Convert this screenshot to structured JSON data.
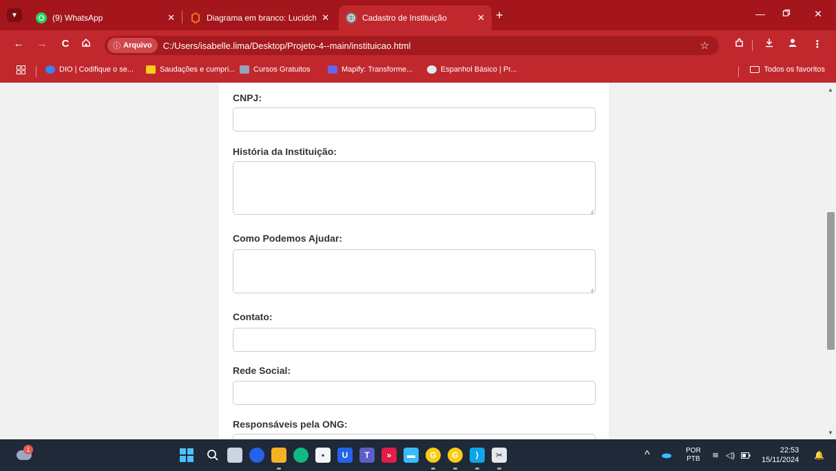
{
  "tabs": [
    {
      "title": "(9) WhatsApp",
      "icon": "whatsapp-icon",
      "active": false
    },
    {
      "title": "Diagrama em branco: Lucidchart",
      "icon": "lucidchart-icon",
      "active": false
    },
    {
      "title": "Cadastro de Instituição",
      "icon": "globe-icon",
      "active": true
    }
  ],
  "address": {
    "chip": "Arquivo",
    "url": "C:/Users/isabelle.lima/Desktop/Projeto-4--main/instituicao.html"
  },
  "bookmarks": [
    {
      "label": "DIO | Codifique o se...",
      "color": "#3b82f6"
    },
    {
      "label": "Saudações e cumpri...",
      "color": "#facc15"
    },
    {
      "label": "Cursos Gratuitos",
      "color": "#94a3b8"
    },
    {
      "label": "Mapify: Transforme...",
      "color": "#6366f1"
    },
    {
      "label": "Espanhol Básico | Pr...",
      "color": "#e2e8f0"
    }
  ],
  "bookmarks_all": "Todos os favoritos",
  "form": {
    "cnpj_label": "CNPJ:",
    "historia_label": "História da Instituição:",
    "ajudar_label": "Como Podemos Ajudar:",
    "contato_label": "Contato:",
    "rede_label": "Rede Social:",
    "responsaveis_label": "Responsáveis pela ONG:"
  },
  "taskbar": {
    "weather_badge": "1",
    "lang_top": "POR",
    "lang_bottom": "PTB",
    "time": "22:53",
    "date": "15/11/2024"
  },
  "colors": {
    "chrome": "#c0282d",
    "tabstrip": "#a4161c",
    "taskbar": "#1f2937"
  }
}
